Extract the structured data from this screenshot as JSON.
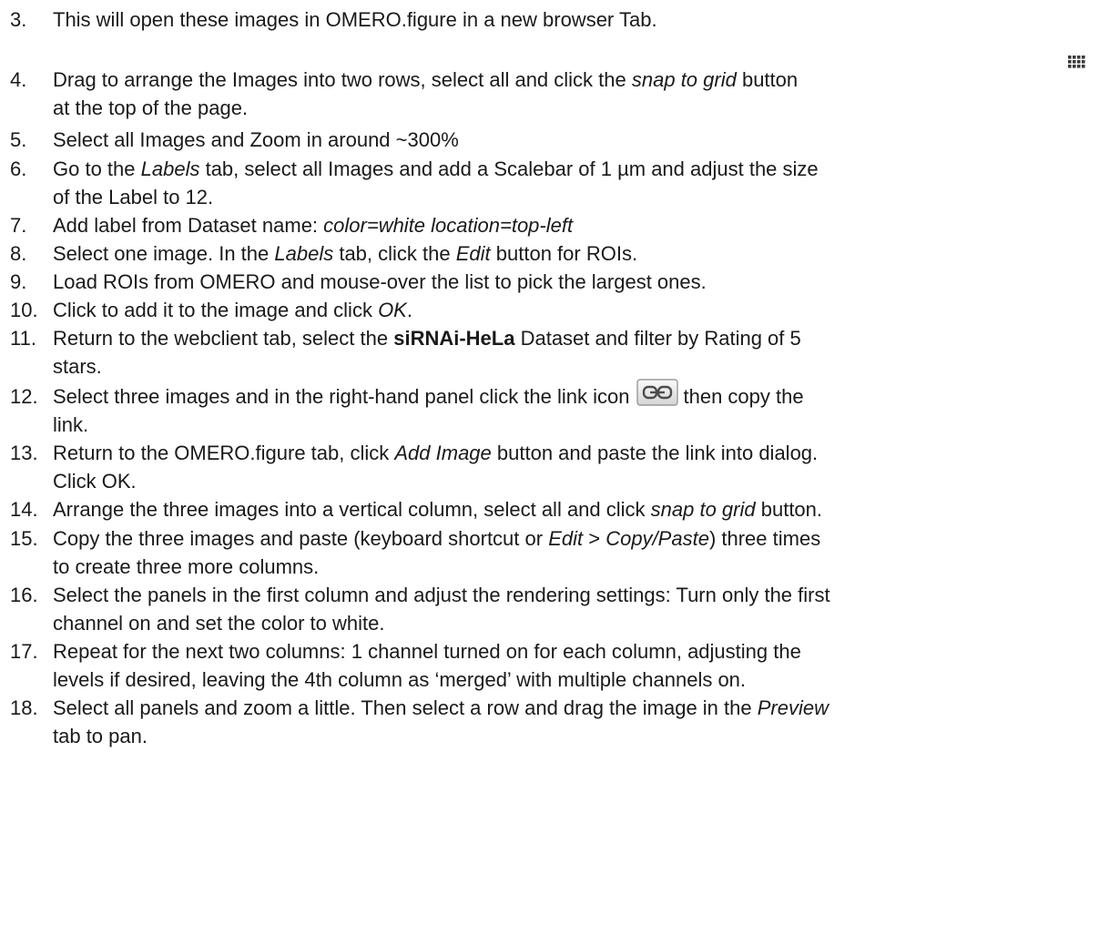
{
  "steps": [
    {
      "num": "3.",
      "parts": [
        {
          "t": "This will open these images in OMERO.figure in a new browser Tab."
        }
      ]
    },
    {
      "num": "4.",
      "line1": [
        {
          "t": "Drag to arrange the Images into two rows, select all and click the "
        },
        {
          "t": "snap to grid",
          "i": true
        },
        {
          "t": " button"
        }
      ],
      "line2": [
        {
          "t": "at the top of the page."
        }
      ],
      "icon": "grid-icon"
    },
    {
      "num": "5.",
      "parts": [
        {
          "t": "Select all Images and Zoom in around ~300%"
        }
      ]
    },
    {
      "num": "6.",
      "line1": [
        {
          "t": "Go to the "
        },
        {
          "t": "Labels",
          "i": true
        },
        {
          "t": " tab, select all Images and add a Scalebar of 1 µm and adjust the size"
        }
      ],
      "line2": [
        {
          "t": "of the Label to 12."
        }
      ]
    },
    {
      "num": "7.",
      "parts": [
        {
          "t": "Add label from Dataset name: "
        },
        {
          "t": "color=white location=top-left",
          "i": true
        }
      ]
    },
    {
      "num": "8.",
      "parts": [
        {
          "t": "Select one image. In the "
        },
        {
          "t": "Labels",
          "i": true
        },
        {
          "t": " tab, click the "
        },
        {
          "t": "Edit",
          "i": true
        },
        {
          "t": " button for ROIs."
        }
      ]
    },
    {
      "num": "9.",
      "parts": [
        {
          "t": "Load ROIs from OMERO and mouse-over the list to pick the largest ones."
        }
      ]
    },
    {
      "num": "10.",
      "parts": [
        {
          "t": "Click to add it to the image and click "
        },
        {
          "t": "OK",
          "i": true
        },
        {
          "t": "."
        }
      ]
    },
    {
      "num": "11.",
      "line1": [
        {
          "t": "Return to the webclient tab, select the "
        },
        {
          "t": "siRNAi-HeLa",
          "b": true
        },
        {
          "t": " Dataset and filter by Rating of 5"
        }
      ],
      "line2": [
        {
          "t": "stars."
        }
      ]
    },
    {
      "num": "12.",
      "line1": [
        {
          "t": "Select three images and in the right-hand panel click the link icon"
        },
        {
          "icon": "link-icon"
        },
        {
          "t": "then copy the"
        }
      ],
      "line2": [
        {
          "t": "link."
        }
      ]
    },
    {
      "num": "13.",
      "line1": [
        {
          "t": "Return to the OMERO.figure tab, click "
        },
        {
          "t": "Add Image",
          "i": true
        },
        {
          "t": " button and paste the link into dialog."
        }
      ],
      "line2": [
        {
          "t": "Click OK."
        }
      ]
    },
    {
      "num": "14.",
      "parts": [
        {
          "t": "Arrange the three images into a vertical column, select all and click "
        },
        {
          "t": "snap to grid",
          "i": true
        },
        {
          "t": " button."
        }
      ]
    },
    {
      "num": "15.",
      "line1": [
        {
          "t": "Copy the three images and paste (keyboard shortcut or "
        },
        {
          "t": "Edit",
          "i": true
        },
        {
          "t": " > "
        },
        {
          "t": "Copy/Paste",
          "i": true
        },
        {
          "t": ") three times"
        }
      ],
      "line2": [
        {
          "t": "to create three more columns."
        }
      ]
    },
    {
      "num": "16.",
      "line1": [
        {
          "t": "Select the panels in the first column and adjust the rendering settings: Turn only the first"
        }
      ],
      "line2": [
        {
          "t": "channel on and set the color to white."
        }
      ]
    },
    {
      "num": "17.",
      "line1": [
        {
          "t": "Repeat for the next two columns: 1 channel turned on for each column, adjusting the"
        }
      ],
      "line2": [
        {
          "t": "levels if desired, leaving the 4th column as ‘merged’ with multiple channels on."
        }
      ]
    },
    {
      "num": "18.",
      "line1": [
        {
          "t": "Select all panels and zoom a little. Then select a row and drag the image in the "
        },
        {
          "t": "Preview",
          "i": true
        }
      ],
      "line2": [
        {
          "t": "tab to pan."
        }
      ]
    }
  ]
}
